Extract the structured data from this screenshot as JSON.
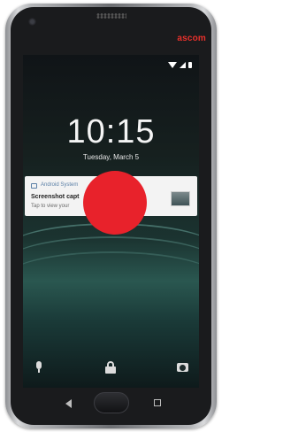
{
  "device": {
    "brand": "ascom"
  },
  "lock_screen": {
    "time": "10:15",
    "date": "Tuesday, March 5"
  },
  "notification": {
    "app_name": "Android System",
    "title": "Screenshot capt",
    "text": "Tap to view your"
  },
  "shortcuts": [
    "mic-icon",
    "lock-icon",
    "camera-icon"
  ],
  "navigation": [
    "back-button",
    "home-button",
    "recents-button"
  ],
  "colors": {
    "brand": "#e8302b",
    "touch_indicator": "#e8222b",
    "notification_bg": "#f3f3f3"
  }
}
